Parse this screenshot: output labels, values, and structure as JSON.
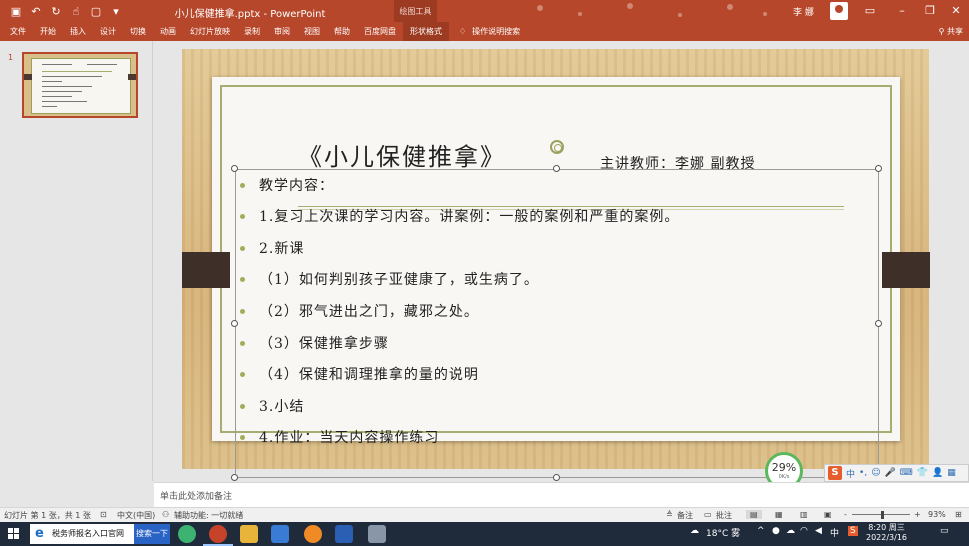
{
  "window": {
    "title": "小儿保健推拿.pptx - PowerPoint",
    "contextual_tools": "绘图工具",
    "user": "李 娜",
    "qat_icons": [
      "save-icon",
      "undo-icon",
      "redo-icon",
      "touch-mode-icon",
      "new-file-icon"
    ]
  },
  "ribbon": {
    "tabs": [
      "文件",
      "开始",
      "插入",
      "设计",
      "切换",
      "动画",
      "幻灯片放映",
      "录制",
      "审阅",
      "视图",
      "帮助",
      "百度网盘",
      "形状格式"
    ],
    "active_tab": "形状格式",
    "tell_me": "操作说明搜索",
    "share": "共享"
  },
  "thumbnails": {
    "slide_number": "1"
  },
  "slide": {
    "title": "《小儿保健推拿》",
    "subtitle": "主讲教师：李娜  副教授",
    "bullets": [
      "教学内容：",
      "1.复习上次课的学习内容。讲案例：一般的案例和严重的案例。",
      "2.新课",
      "（1）如何判别孩子亚健康了，或生病了。",
      "（2）邪气进出之门，藏邪之处。",
      "（3）保健推拿步骤",
      "（4）保健和调理推拿的量的说明",
      "3.小结",
      "4.作业：当天内容操作练习"
    ],
    "colors": {
      "bullet": "#a4ab5c",
      "border": "#a7ad70",
      "wood": "#d6b37a",
      "band": "#3e3029"
    }
  },
  "overlay": {
    "perf_percent": "29%",
    "perf_speed": "0K/s",
    "ime": [
      "中",
      "•,",
      "☺",
      "🎤",
      "⌨",
      "👕",
      "👤",
      "▦"
    ]
  },
  "notes": {
    "placeholder": "单击此处添加备注"
  },
  "statusbar": {
    "slide_info": "幻灯片 第 1 张，共 1 张",
    "language": "中文(中国)",
    "accessibility": "辅助功能: 一切就绪",
    "notes_btn": "备注",
    "comments_btn": "批注",
    "zoom": "93%",
    "zoom_minus": "-",
    "zoom_plus": "+"
  },
  "taskbar": {
    "search_text": "税务师报名入口官网",
    "search_button": "搜索一下",
    "weather": "18°C 雾",
    "ime_indicator": "中",
    "time": "8:20 周三",
    "date": "2022/3/16"
  }
}
